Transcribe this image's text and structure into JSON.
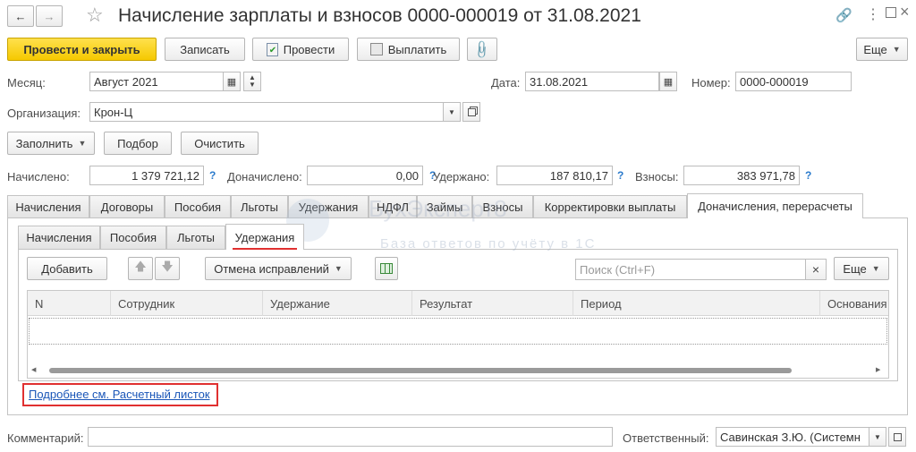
{
  "header": {
    "title": "Начисление зарплаты и взносов 0000-000019 от 31.08.2021"
  },
  "toolbar": {
    "post_and_close": "Провести и закрыть",
    "save": "Записать",
    "post": "Провести",
    "pay": "Выплатить",
    "more": "Еще"
  },
  "form": {
    "month_label": "Месяц:",
    "month_value": "Август 2021",
    "date_label": "Дата:",
    "date_value": "31.08.2021",
    "number_label": "Номер:",
    "number_value": "0000-000019",
    "org_label": "Организация:",
    "org_value": "Крон-Ц"
  },
  "actions": {
    "fill": "Заполнить",
    "select": "Подбор",
    "clear": "Очистить"
  },
  "totals": {
    "accrued_label": "Начислено:",
    "accrued_value": "1 379 721,12",
    "additional_label": "Доначислено:",
    "additional_value": "0,00",
    "withheld_label": "Удержано:",
    "withheld_value": "187 810,17",
    "contrib_label": "Взносы:",
    "contrib_value": "383 971,78",
    "help": "?"
  },
  "tabs": [
    {
      "label": "Начисления"
    },
    {
      "label": "Договоры"
    },
    {
      "label": "Пособия"
    },
    {
      "label": "Льготы"
    },
    {
      "label": "Удержания"
    },
    {
      "label": "НДФЛ"
    },
    {
      "label": "Займы"
    },
    {
      "label": "Взносы"
    },
    {
      "label": "Корректировки выплаты"
    },
    {
      "label": "Доначисления, перерасчеты"
    }
  ],
  "subtabs": [
    {
      "label": "Начисления"
    },
    {
      "label": "Пособия"
    },
    {
      "label": "Льготы"
    },
    {
      "label": "Удержания"
    }
  ],
  "table_toolbar": {
    "add": "Добавить",
    "cancel_corrections": "Отмена исправлений",
    "search_placeholder": "Поиск (Ctrl+F)",
    "more": "Еще"
  },
  "table": {
    "columns": [
      "N",
      "Сотрудник",
      "Удержание",
      "Результат",
      "Период",
      "Основания"
    ]
  },
  "link": {
    "payslip": "Подробнее см. Расчетный листок"
  },
  "footer": {
    "comment_label": "Комментарий:",
    "comment_value": "",
    "responsible_label": "Ответственный:",
    "responsible_value": "Савинская З.Ю. (Системн"
  },
  "watermark": {
    "title": "БухЭксперт8",
    "subtitle": "База ответов по учёту в 1С"
  },
  "colors": {
    "accent_yellow": "#f5c900",
    "link_blue": "#1a56b8",
    "highlight_red": "#e03030",
    "help_blue": "#2a7acc"
  }
}
